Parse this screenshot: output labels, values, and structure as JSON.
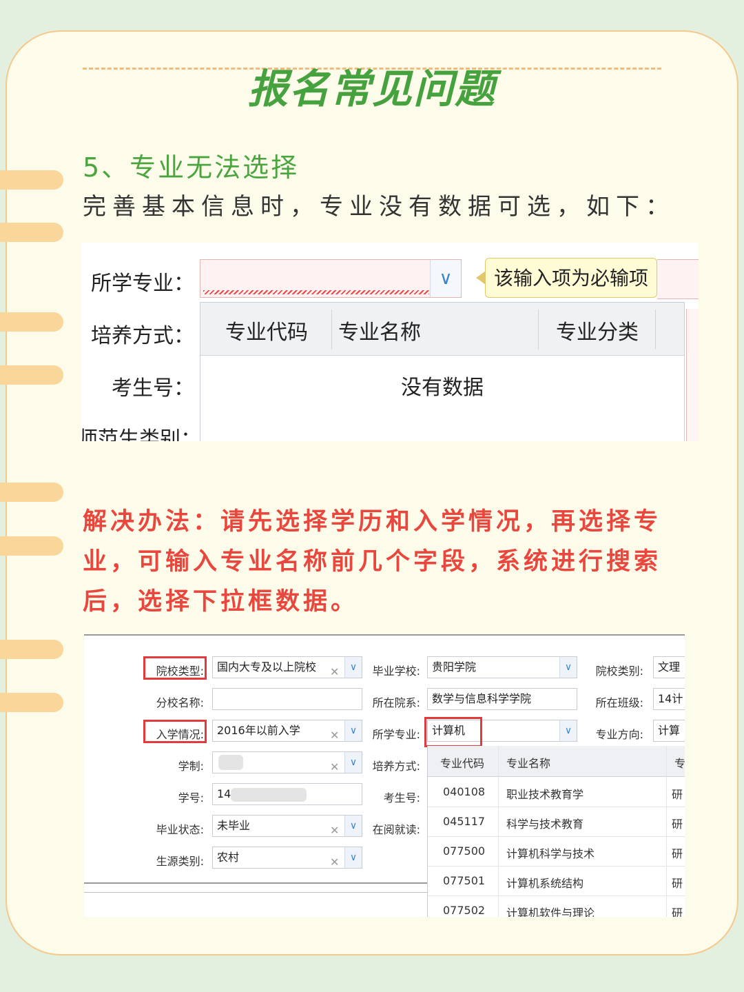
{
  "title": "报名常见问题",
  "section_heading": "5、专业无法选择",
  "description": "完善基本信息时，专业没有数据可选，如下：",
  "solution": "解决办法：请先选择学历和入学情况，再选择专业，可输入专业名称前几个字段，系统进行搜索后，选择下拉框数据。",
  "colors": {
    "title": "#46a23e",
    "heading": "#4aa53e",
    "solution": "#e9473d",
    "card": "#fdfbea",
    "border": "#f5c98b"
  },
  "screenshot1": {
    "labels": {
      "major": "所学专业：",
      "mode": "培养方式：",
      "exam_no": "考生号：",
      "normal_cat": "师范生类别："
    },
    "tooltip": "该输入项为必输项",
    "columns": [
      "专业代码",
      "专业名称",
      "专业分类"
    ],
    "empty_text": "没有数据"
  },
  "screenshot2": {
    "labels": {
      "school_type": "院校类型:",
      "branch": "分校名称:",
      "entry": "入学情况:",
      "length": "学制:",
      "student_no": "学号:",
      "grad_status": "毕业状态:",
      "source": "生源类别:",
      "grad_school": "毕业学校:",
      "dept": "所在院系:",
      "major": "所学专业:",
      "mode": "培养方式:",
      "exam_no": "考生号:",
      "studying": "在阅就读:",
      "school_cat": "院校类别:",
      "class": "所在班级:",
      "direction": "专业方向:"
    },
    "values": {
      "school_type": "国内大专及以上院校",
      "entry": "2016年以前入学",
      "student_no": "14",
      "grad_status": "未毕业",
      "source": "农村",
      "grad_school": "贵阳学院",
      "dept": "数学与信息科学学院",
      "major": "计算机",
      "school_cat": "文理",
      "class": "14计",
      "direction": "计算"
    },
    "columns": [
      "专业代码",
      "专业名称",
      "专"
    ],
    "rows": [
      {
        "code": "040108",
        "name": "职业技术教育学",
        "cat": "研"
      },
      {
        "code": "045117",
        "name": "科学与技术教育",
        "cat": "研"
      },
      {
        "code": "077500",
        "name": "计算机科学与技术",
        "cat": "研"
      },
      {
        "code": "077501",
        "name": "计算机系统结构",
        "cat": "研"
      },
      {
        "code": "077502",
        "name": "计算机软件与理论",
        "cat": "研"
      }
    ]
  }
}
